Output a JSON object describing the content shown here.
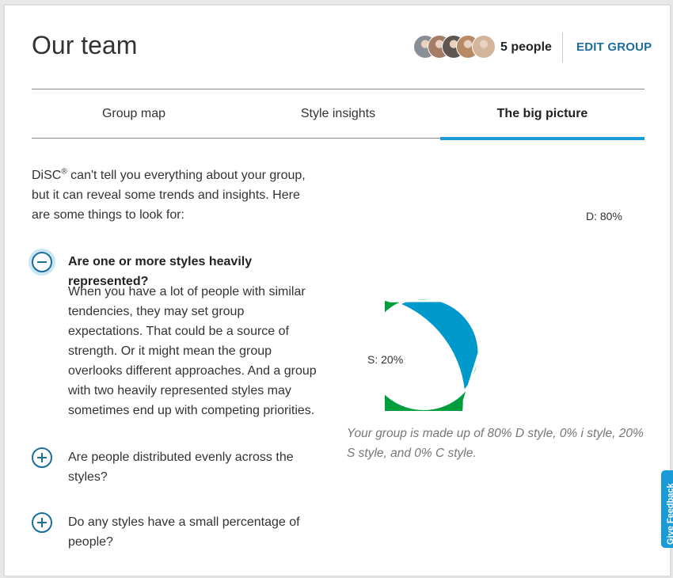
{
  "header": {
    "title": "Our team",
    "people_count": "5 people",
    "edit_label": "EDIT GROUP",
    "avatars": [
      {
        "name": "member-1",
        "color": "#8a8f95"
      },
      {
        "name": "member-2",
        "color": "#a57c66"
      },
      {
        "name": "member-3",
        "color": "#5e5650"
      },
      {
        "name": "member-4",
        "color": "#b58a64"
      },
      {
        "name": "member-5",
        "color": "#d2b59a"
      }
    ]
  },
  "tabs": [
    {
      "label": "Group map"
    },
    {
      "label": "Style insights"
    },
    {
      "label": "The big picture",
      "active": true
    }
  ],
  "intro": {
    "brand": "DiSC",
    "mark": "®",
    "text": " can't tell you everything about your group, but it can reveal some trends and insights. Here are some things to look for:"
  },
  "accordion": [
    {
      "question": "Are one or more styles heavily represented?",
      "expanded": true,
      "icon": "minus-circle-icon",
      "answer": "When you have a lot of people with similar tendencies, they may set group expectations. That could be a source of strength. Or it might mean the group overlooks different approaches. And a group with two heavily represented styles may sometimes end up with competing priorities."
    },
    {
      "question": "Are people distributed evenly across the styles?",
      "expanded": false,
      "icon": "plus-circle-icon"
    },
    {
      "question": "Do any styles have a small percentage of people?",
      "expanded": false,
      "icon": "plus-circle-icon"
    }
  ],
  "chart_data": {
    "type": "pie",
    "variant": "donut",
    "slices": [
      {
        "label": "D: 80%",
        "value": 80,
        "color": "#009e3d"
      },
      {
        "label": "S: 20%",
        "value": 20,
        "color": "#0099cc"
      }
    ]
  },
  "caption": "Your group is made up of 80% D style, 0% i style, 20% S style, and 0% C style.",
  "feedback_label": "Give Feedback",
  "colors": {
    "accent": "#1a9ad6",
    "link": "#1b6d9c",
    "d_style": "#009e3d",
    "s_style": "#0099cc"
  }
}
